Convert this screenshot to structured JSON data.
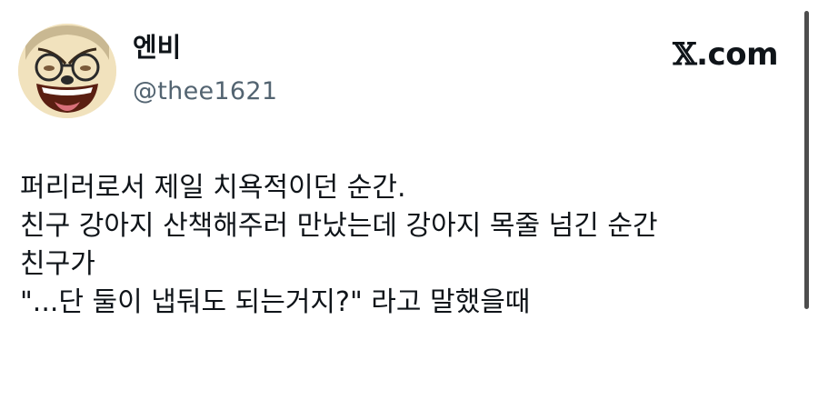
{
  "user": {
    "display_name": "엔비",
    "handle": "@thee1621"
  },
  "brand": {
    "prefix": "𝕏",
    "suffix": ".com"
  },
  "tweet": {
    "lines": [
      "퍼리러로서 제일 치욕적이던 순간.",
      "친구 강아지 산책해주러 만났는데 강아지 목줄 넘긴 순간",
      "친구가",
      "\"...단 둘이 냅둬도 되는거지?\" 라고 말했을때"
    ]
  },
  "colors": {
    "text": "#0f1419",
    "secondary": "#536471",
    "background": "#ffffff"
  }
}
